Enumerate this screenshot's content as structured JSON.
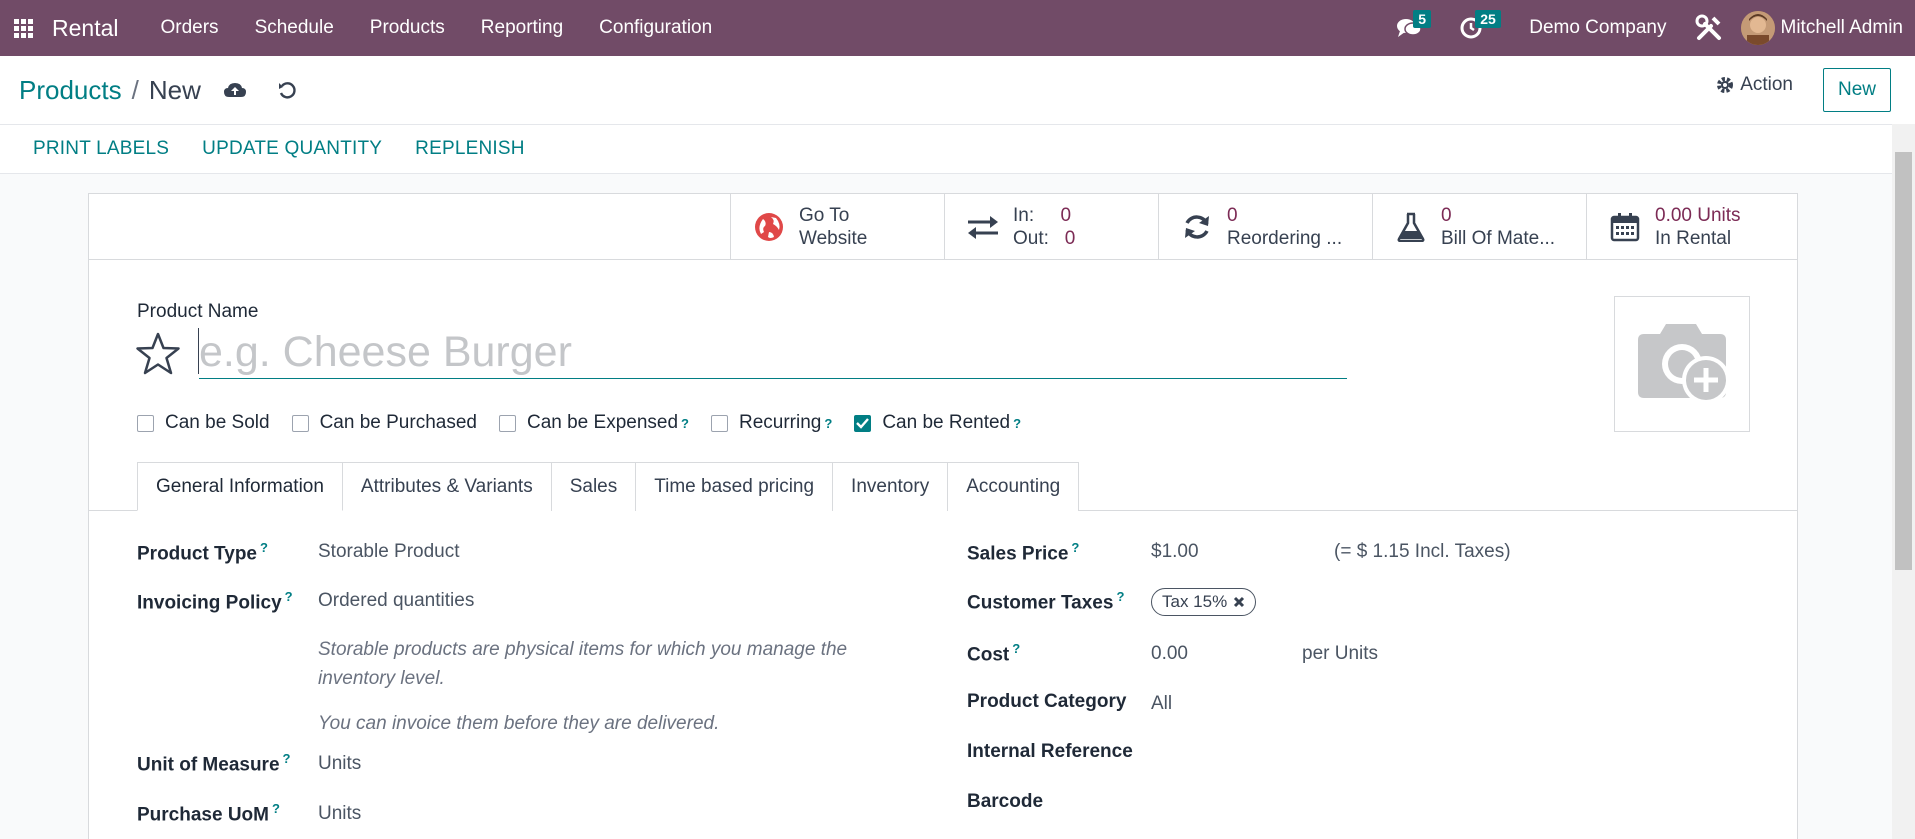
{
  "topbar": {
    "app_name": "Rental",
    "menu": [
      "Orders",
      "Schedule",
      "Products",
      "Reporting",
      "Configuration"
    ],
    "messages_count": "5",
    "activities_count": "25",
    "company": "Demo Company",
    "user": "Mitchell Admin",
    "bg_color": "#714b67"
  },
  "control": {
    "breadcrumb_parent": "Products",
    "breadcrumb_sep": "/",
    "breadcrumb_current": "New",
    "action_label": "Action",
    "new_label": "New"
  },
  "statusbar": {
    "print_labels": "PRINT LABELS",
    "update_quantity": "UPDATE QUANTITY",
    "replenish": "REPLENISH"
  },
  "smart_buttons": {
    "website": {
      "line1": "Go To",
      "line2": "Website"
    },
    "moves": {
      "in_label": "In:",
      "in_value": "0",
      "out_label": "Out:",
      "out_value": "0"
    },
    "reordering": {
      "value": "0",
      "label": "Reordering ..."
    },
    "bom": {
      "value": "0",
      "label": "Bill Of Mate..."
    },
    "rental": {
      "value": "0.00 Units",
      "label": "In Rental"
    }
  },
  "form": {
    "product_name_label": "Product Name",
    "product_name_placeholder": "e.g. Cheese Burger",
    "checkboxes": [
      {
        "label": "Can be Sold",
        "checked": false,
        "help": false
      },
      {
        "label": "Can be Purchased",
        "checked": false,
        "help": false
      },
      {
        "label": "Can be Expensed",
        "checked": false,
        "help": true
      },
      {
        "label": "Recurring",
        "checked": false,
        "help": true
      },
      {
        "label": "Can be Rented",
        "checked": true,
        "help": true
      }
    ],
    "help_mark": "?",
    "tabs": [
      "General Information",
      "Attributes & Variants",
      "Sales",
      "Time based pricing",
      "Inventory",
      "Accounting"
    ],
    "active_tab": "General Information",
    "left": {
      "product_type_label": "Product Type",
      "product_type_value": "Storable Product",
      "invoicing_policy_label": "Invoicing Policy",
      "invoicing_policy_value": "Ordered quantities",
      "note1": "Storable products are physical items for which you manage the inventory level.",
      "note2": "You can invoice them before they are delivered.",
      "uom_label": "Unit of Measure",
      "uom_value": "Units",
      "purchase_uom_label": "Purchase UoM",
      "purchase_uom_value": "Units"
    },
    "right": {
      "sales_price_label": "Sales Price",
      "sales_price_value": "$1.00",
      "sales_price_incl": "(= $ 1.15 Incl. Taxes)",
      "customer_taxes_label": "Customer Taxes",
      "customer_taxes_tag": "Tax 15%",
      "cost_label": "Cost",
      "cost_value": "0.00",
      "cost_unit": "per Units",
      "category_label": "Product Category",
      "category_value": "All",
      "internal_ref_label": "Internal Reference",
      "barcode_label": "Barcode"
    }
  }
}
